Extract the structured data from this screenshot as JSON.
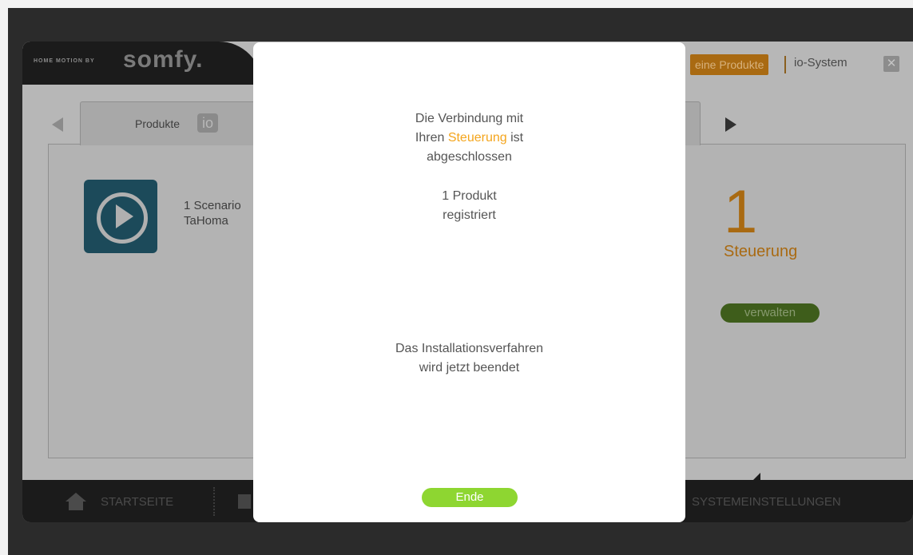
{
  "header": {
    "brand_tagline": "HOME MOTION BY",
    "brand_name": "somfy.",
    "nav_products": "eine Produkte",
    "nav_io_system": "io-System",
    "close_symbol": "✕"
  },
  "tab": {
    "label": "Produkte",
    "badge": "io"
  },
  "content": {
    "scenario_line1": "1 Scenario",
    "scenario_line2": "TaHoma",
    "count": "1",
    "count_label": "Steuerung",
    "manage_button": "verwalten"
  },
  "footer": {
    "home_label": "STARTSEITE",
    "system_label": "SYSTEMEINSTELLUNGEN"
  },
  "modal": {
    "line1": "Die Verbindung mit",
    "line2_prefix": "Ihren ",
    "line2_accent": "Steuerung",
    "line2_suffix": " ist",
    "line3": "abgeschlossen",
    "count_line1": "1 Produkt",
    "count_line2": "registriert",
    "status_line1": "Das Installationsverfahren",
    "status_line2": "wird jetzt beendet",
    "end_button": "Ende"
  },
  "colors": {
    "accent_orange": "#f4a51c",
    "button_green": "#8ed631"
  }
}
